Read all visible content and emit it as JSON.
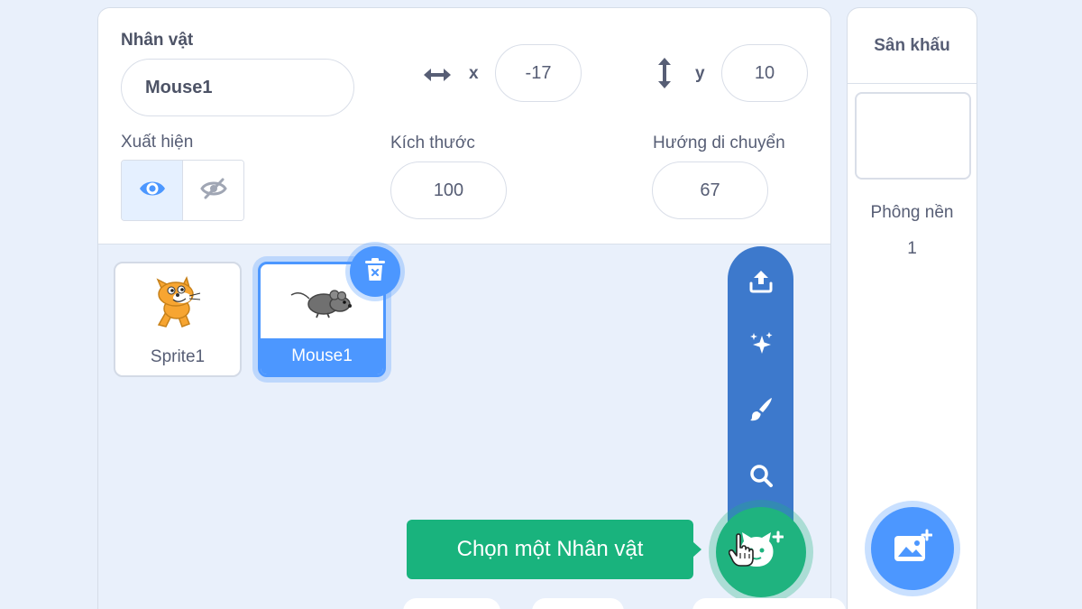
{
  "sprite_info": {
    "sprite_label": "Nhân vật",
    "sprite_name": "Mouse1",
    "x_label": "x",
    "x_value": "-17",
    "y_label": "y",
    "y_value": "10",
    "show_label": "Xuất hiện",
    "size_label": "Kích thước",
    "size_value": "100",
    "direction_label": "Hướng di chuyển",
    "direction_value": "67"
  },
  "sprites": [
    {
      "name": "Sprite1",
      "selected": false
    },
    {
      "name": "Mouse1",
      "selected": true
    }
  ],
  "add_sprite_menu": {
    "items": [
      "upload-icon",
      "surprise-icon",
      "paint-icon",
      "search-icon"
    ],
    "tooltip": "Chọn một Nhân vật"
  },
  "stage": {
    "header": "Sân khấu",
    "backdrops_label": "Phông nền",
    "backdrops_count": "1"
  },
  "colors": {
    "accent_blue": "#4c97ff",
    "menu_blue": "#3d79cc",
    "tooltip_green": "#19b37d",
    "text_gray": "#575e75"
  }
}
